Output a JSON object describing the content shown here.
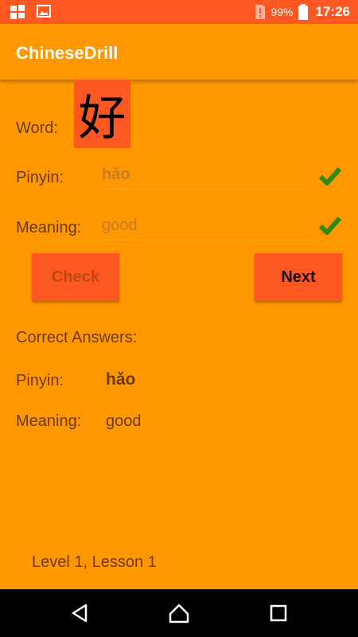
{
  "status_bar": {
    "battery": "99%",
    "time": "17:26"
  },
  "app_bar": {
    "title": "ChineseDrill"
  },
  "quiz": {
    "word_label": "Word:",
    "character": "好",
    "pinyin_label": "Pinyin:",
    "pinyin_input": "hǎo",
    "meaning_label": "Meaning:",
    "meaning_input": "good",
    "check_button": "Check",
    "next_button": "Next"
  },
  "answers": {
    "heading": "Correct Answers:",
    "pinyin_label": "Pinyin:",
    "pinyin_value": "hǎo",
    "meaning_label": "Meaning:",
    "meaning_value": "good"
  },
  "footer": {
    "level_text": "Level 1, Lesson 1"
  },
  "colors": {
    "primary": "#ff9800",
    "accent": "#ff5722",
    "check_green": "#2e8b10"
  }
}
